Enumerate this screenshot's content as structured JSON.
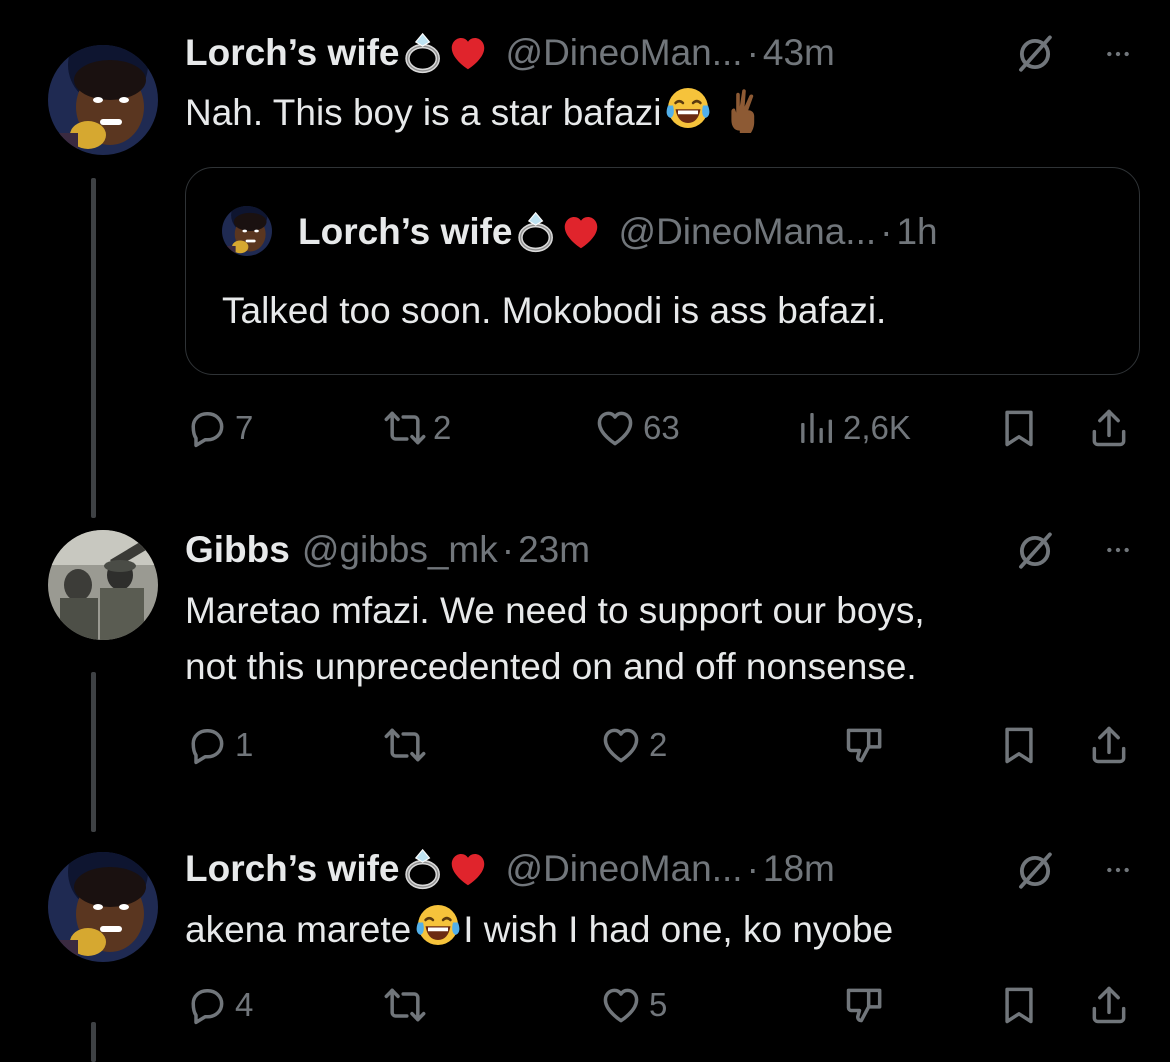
{
  "tweets": [
    {
      "name": "Lorch’s wife",
      "handle": "@DineoMan...",
      "separator": "·",
      "time": "43m",
      "text": "Nah. This boy is a star bafazi",
      "quote": {
        "name": "Lorch’s wife",
        "handle": "@DineoMana...",
        "separator": "·",
        "time": "1h",
        "text": "Talked too soon. Mokobodi is ass bafazi."
      },
      "actions": {
        "replies": "7",
        "reposts": "2",
        "likes": "63",
        "views": "2,6K"
      }
    },
    {
      "name": "Gibbs",
      "handle": "@gibbs_mk",
      "separator": "·",
      "time": "23m",
      "text_line1": "Maretao mfazi. We need to support our boys,",
      "text_line2": "not this unprecedented on and off nonsense.",
      "actions": {
        "replies": "1",
        "reposts": "",
        "likes": "2"
      }
    },
    {
      "name": "Lorch’s wife",
      "handle": "@DineoMan...",
      "separator": "·",
      "time": "18m",
      "text_before": "akena marete",
      "text_after": "I wish I had one, ko nyobe",
      "actions": {
        "replies": "4",
        "reposts": "",
        "likes": "5"
      }
    }
  ],
  "icons": {
    "reply": "reply-icon",
    "repost": "repost-icon",
    "like": "heart-icon",
    "views": "views-icon",
    "bookmark": "bookmark-icon",
    "share": "share-icon",
    "grok": "grok-icon",
    "more": "more-icon",
    "downvote": "downvote-icon"
  },
  "colors": {
    "background": "#000000",
    "text": "#e7e9ea",
    "muted": "#71767b",
    "border": "#2f3336"
  }
}
